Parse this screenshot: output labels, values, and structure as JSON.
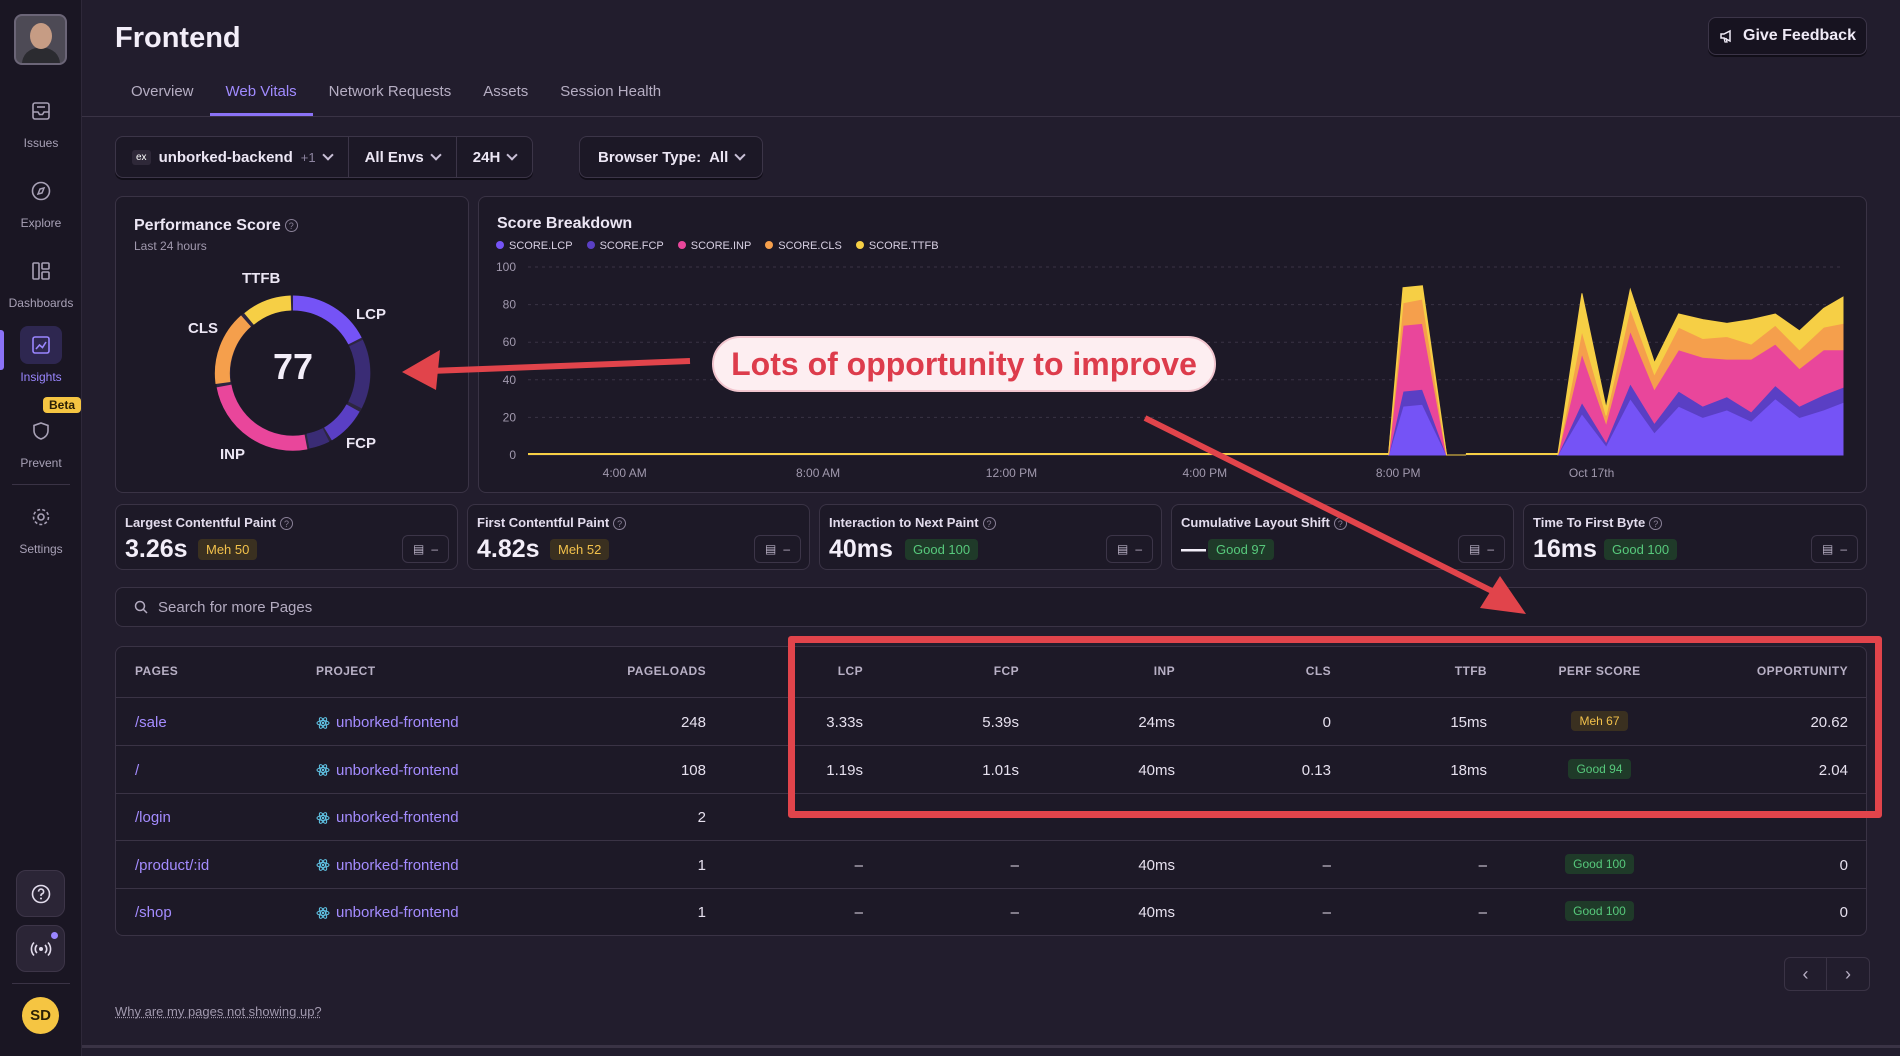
{
  "sidebar": {
    "items": [
      {
        "label": "Issues"
      },
      {
        "label": "Explore"
      },
      {
        "label": "Dashboards"
      },
      {
        "label": "Insights"
      },
      {
        "label": "Prevent"
      },
      {
        "label": "Settings"
      }
    ],
    "beta_label": "Beta",
    "user_initials": "SD"
  },
  "header": {
    "title": "Frontend",
    "feedback_label": "Give Feedback",
    "tabs": [
      "Overview",
      "Web Vitals",
      "Network Requests",
      "Assets",
      "Session Health"
    ],
    "active_tab": "Web Vitals"
  },
  "filters": {
    "project_badge": "ex",
    "project": "unborked-backend",
    "project_extra": "+1",
    "env": "All Envs",
    "period": "24H",
    "browser_label": "Browser Type:",
    "browser_value": "All"
  },
  "performance_score": {
    "title": "Performance Score",
    "subtitle": "Last 24 hours",
    "value": "77",
    "labels": {
      "ttfb": "TTFB",
      "lcp": "LCP",
      "fcp": "FCP",
      "inp": "INP",
      "cls": "CLS"
    }
  },
  "score_breakdown": {
    "title": "Score Breakdown",
    "legend": [
      {
        "label": "SCORE.LCP",
        "color": "#7553f6"
      },
      {
        "label": "SCORE.FCP",
        "color": "#5a3fc4"
      },
      {
        "label": "SCORE.INP",
        "color": "#e9469b"
      },
      {
        "label": "SCORE.CLS",
        "color": "#f59f4c"
      },
      {
        "label": "SCORE.TTFB",
        "color": "#f6cf45"
      }
    ]
  },
  "chart_data": {
    "type": "area",
    "title": "Score Breakdown",
    "x_ticks": [
      "4:00 AM",
      "8:00 AM",
      "12:00 PM",
      "4:00 PM",
      "8:00 PM",
      "Oct 17th"
    ],
    "y_ticks": [
      "0",
      "20",
      "40",
      "60",
      "80",
      "100"
    ],
    "ylim": [
      0,
      100
    ],
    "x_hours": [
      19.8,
      20.1,
      20.5,
      21.0,
      21.4,
      23.3,
      23.8,
      24.3,
      24.8,
      25.3,
      25.8,
      26.3,
      26.8,
      27.3,
      27.8,
      28.3,
      28.8,
      29.2
    ],
    "series": [
      {
        "name": "SCORE.LCP",
        "values": [
          0,
          26,
          27,
          0,
          0,
          0,
          22,
          5,
          30,
          12,
          26,
          20,
          24,
          18,
          30,
          20,
          24,
          28
        ]
      },
      {
        "name": "SCORE.FCP",
        "values": [
          0,
          8,
          8,
          0,
          0,
          0,
          6,
          2,
          8,
          5,
          8,
          6,
          7,
          5,
          7,
          6,
          8,
          8
        ]
      },
      {
        "name": "SCORE.INP",
        "values": [
          0,
          35,
          35,
          0,
          0,
          0,
          26,
          10,
          28,
          18,
          22,
          26,
          20,
          28,
          22,
          20,
          24,
          20
        ]
      },
      {
        "name": "SCORE.CLS",
        "values": [
          0,
          12,
          13,
          0,
          0,
          0,
          12,
          4,
          12,
          8,
          12,
          10,
          12,
          8,
          10,
          10,
          12,
          14
        ]
      },
      {
        "name": "SCORE.TTFB",
        "values": [
          0,
          8,
          7,
          0,
          0,
          0,
          20,
          4,
          10,
          6,
          7,
          10,
          7,
          13,
          6,
          10,
          10,
          14
        ]
      }
    ]
  },
  "vitals": [
    {
      "name": "Largest Contentful Paint",
      "value": "3.26s",
      "badge": "Meh 50",
      "status": "meh"
    },
    {
      "name": "First Contentful Paint",
      "value": "4.82s",
      "badge": "Meh 52",
      "status": "meh"
    },
    {
      "name": "Interaction to Next Paint",
      "value": "40ms",
      "badge": "Good 100",
      "status": "good"
    },
    {
      "name": "Cumulative Layout Shift",
      "value": "—",
      "badge": "Good 97",
      "status": "good"
    },
    {
      "name": "Time To First Byte",
      "value": "16ms",
      "badge": "Good 100",
      "status": "good"
    }
  ],
  "search": {
    "placeholder": "Search for more Pages"
  },
  "table": {
    "headers": [
      "PAGES",
      "PROJECT",
      "PAGELOADS",
      "LCP",
      "FCP",
      "INP",
      "CLS",
      "TTFB",
      "PERF SCORE",
      "OPPORTUNITY"
    ],
    "rows": [
      {
        "page": "/sale",
        "project": "unborked-frontend",
        "pageloads": "248",
        "lcp": "3.33s",
        "fcp": "5.39s",
        "inp": "24ms",
        "cls": "0",
        "ttfb": "15ms",
        "score": "Meh 67",
        "status": "meh",
        "opportunity": "20.62"
      },
      {
        "page": "/",
        "project": "unborked-frontend",
        "pageloads": "108",
        "lcp": "1.19s",
        "fcp": "1.01s",
        "inp": "40ms",
        "cls": "0.13",
        "ttfb": "18ms",
        "score": "Good 94",
        "status": "good",
        "opportunity": "2.04"
      },
      {
        "page": "/login",
        "project": "unborked-frontend",
        "pageloads": "2",
        "lcp": "",
        "fcp": "",
        "inp": "",
        "cls": "",
        "ttfb": "",
        "score": "",
        "status": "good",
        "opportunity": ""
      },
      {
        "page": "/product/:id",
        "project": "unborked-frontend",
        "pageloads": "1",
        "lcp": "–",
        "fcp": "–",
        "inp": "40ms",
        "cls": "–",
        "ttfb": "–",
        "score": "Good 100",
        "status": "good",
        "opportunity": "0"
      },
      {
        "page": "/shop",
        "project": "unborked-frontend",
        "pageloads": "1",
        "lcp": "–",
        "fcp": "–",
        "inp": "40ms",
        "cls": "–",
        "ttfb": "–",
        "score": "Good 100",
        "status": "good",
        "opportunity": "0"
      }
    ]
  },
  "footer": {
    "help_link": "Why are my pages not showing up?"
  },
  "annotation": {
    "callout": "Lots of opportunity to improve"
  },
  "colors": {
    "accent": "#8b72f6",
    "annotation": "#e1444b",
    "meh": "#f2c14b",
    "good": "#57c97c"
  }
}
